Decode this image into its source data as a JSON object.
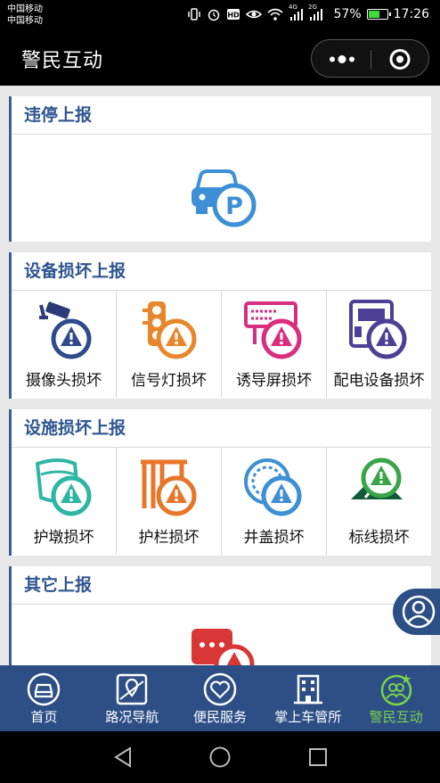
{
  "status_bar": {
    "carrier1": "中国移动",
    "carrier2": "中国移动",
    "battery": "57%",
    "battery_level": 0.57,
    "time": "17:26",
    "signal1_label": "4G",
    "signal2_label": "2G"
  },
  "header": {
    "title": "警民互动"
  },
  "sections": [
    {
      "title": "违停上报",
      "items": []
    },
    {
      "title": "设备损坏上报",
      "items": [
        {
          "label": "摄像头损坏",
          "icon": "camera-warning-icon"
        },
        {
          "label": "信号灯损坏",
          "icon": "traffic-light-warning-icon"
        },
        {
          "label": "诱导屏损坏",
          "icon": "guidance-screen-warning-icon"
        },
        {
          "label": "配电设备损坏",
          "icon": "power-box-warning-icon"
        }
      ]
    },
    {
      "title": "设施损坏上报",
      "items": [
        {
          "label": "护墩损坏",
          "icon": "bollard-warning-icon"
        },
        {
          "label": "护栏损坏",
          "icon": "guardrail-warning-icon"
        },
        {
          "label": "井盖损坏",
          "icon": "manhole-warning-icon"
        },
        {
          "label": "标线损坏",
          "icon": "road-marking-warning-icon"
        }
      ]
    },
    {
      "title": "其它上报",
      "items": []
    }
  ],
  "tabs": [
    {
      "label": "首页",
      "icon": "car-front-icon"
    },
    {
      "label": "路况导航",
      "icon": "map-pin-icon"
    },
    {
      "label": "便民服务",
      "icon": "heart-icon"
    },
    {
      "label": "掌上车管所",
      "icon": "building-icon"
    },
    {
      "label": "警民互动",
      "icon": "people-icon",
      "active": true
    }
  ],
  "colors": {
    "brand": "#2d4f86",
    "section_title": "#2e5590",
    "active_tab": "#7ad24a",
    "icon_blue": "#3d8fd6",
    "icon_orange": "#e8862a",
    "icon_pink": "#d92e7e",
    "icon_purple": "#4d3f96",
    "icon_teal": "#2fb5a4",
    "icon_red": "#d93636",
    "icon_green": "#3aa548",
    "warn_circle": "#2e4a8c"
  }
}
